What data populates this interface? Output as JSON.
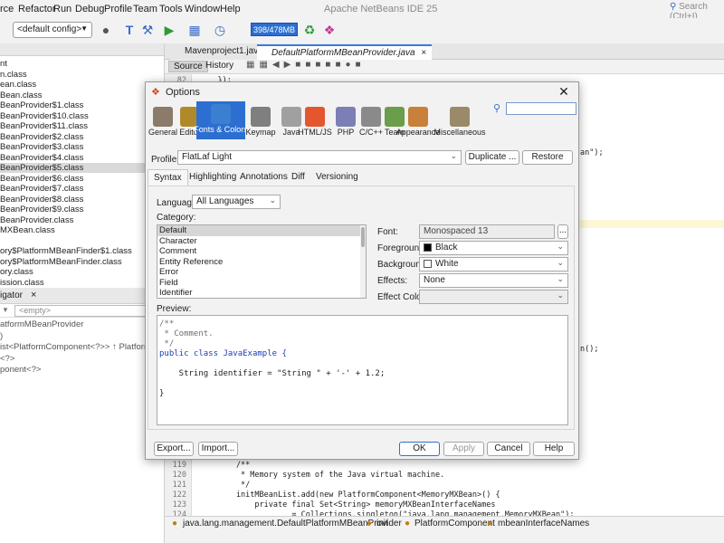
{
  "menubar": {
    "items": [
      "rce",
      "Refactor",
      "Run",
      "Debug",
      "Profile",
      "Team",
      "Tools",
      "Window",
      "Help"
    ],
    "app_title": "Apache NetBeans IDE 25",
    "search_placeholder": "Search (Ctrl+I)"
  },
  "toolbar": {
    "config": "<default config>",
    "memory": "398/478MB"
  },
  "project_tree": {
    "items": [
      "nt",
      "n.class",
      "ean.class",
      "Bean.class",
      "BeanProvider$1.class",
      "BeanProvider$10.class",
      "BeanProvider$11.class",
      "BeanProvider$2.class",
      "BeanProvider$3.class",
      "BeanProvider$4.class",
      "BeanProvider$5.class",
      "BeanProvider$6.class",
      "BeanProvider$7.class",
      "BeanProvider$8.class",
      "BeanProvider$9.class",
      "BeanProvider.class",
      "MXBean.class",
      "",
      "ory$PlatformMBeanFinder$1.class",
      "ory$PlatformMBeanFinder.class",
      "ory.class",
      "ission.class"
    ],
    "selected_index": 10
  },
  "navigator": {
    "tab": "igator",
    "filter": "<empty>",
    "items": [
      "atformMBeanProvider",
      ")",
      "ist<PlatformComponent<?>> ↑ PlatformMBean",
      "<?>",
      "ponent<?>"
    ]
  },
  "editor": {
    "tabs": [
      "Mavenproject1.java",
      "DefaultPlatformMBeanProvider.java"
    ],
    "active_tab": 1,
    "source_label": "Source",
    "history_label": "History",
    "top_lines": [
      {
        "num": "82",
        "code": "    });"
      },
      {
        "num": "83",
        "code": ""
      }
    ],
    "right_fragments": [
      "an\");",
      "n();"
    ],
    "bottom_lines": [
      {
        "num": "119",
        "code": "        /**"
      },
      {
        "num": "120",
        "code": "         * Memory system of the Java virtual machine."
      },
      {
        "num": "121",
        "code": "         */"
      },
      {
        "num": "122",
        "code": "        initMBeanList.add(new PlatformComponent<MemoryMXBean>() {"
      },
      {
        "num": "123",
        "code": "            private final Set<String> memoryMXBeanInterfaceNames"
      },
      {
        "num": "124",
        "code": "                    = Collections.singleton(\"java.lang.management.MemoryMXBean\");"
      }
    ],
    "breadcrumbs": [
      "java.lang.management.DefaultPlatformMBeanProvider",
      "init",
      "PlatformComponent",
      "mbeanInterfaceNames"
    ]
  },
  "dialog": {
    "title": "Options",
    "categories": [
      {
        "label": "General",
        "icon": "general-icon",
        "color": "#8a7b6a"
      },
      {
        "label": "Editor",
        "icon": "editor-icon",
        "color": "#b08a2a"
      },
      {
        "label": "Fonts & Colors",
        "icon": "fonts-colors-icon",
        "color": "#3a7fd0"
      },
      {
        "label": "Keymap",
        "icon": "keymap-icon",
        "color": "#7f7f7f"
      },
      {
        "label": "Java",
        "icon": "java-icon",
        "color": "#a0a0a0"
      },
      {
        "label": "HTML/JS",
        "icon": "html5-icon",
        "color": "#e4572e"
      },
      {
        "label": "PHP",
        "icon": "php-icon",
        "color": "#7b7fb5"
      },
      {
        "label": "C/C++",
        "icon": "cpp-icon",
        "color": "#8a8a8a"
      },
      {
        "label": "Team",
        "icon": "team-icon",
        "color": "#6a9e4a"
      },
      {
        "label": "Appearance",
        "icon": "appearance-icon",
        "color": "#c8803a"
      },
      {
        "label": "Miscellaneous",
        "icon": "miscellaneous-icon",
        "color": "#9a8a6a"
      }
    ],
    "active_category": 2,
    "profile_label": "Profile:",
    "profile_value": "FlatLaf Light",
    "duplicate_label": "Duplicate ...",
    "restore_label": "Restore",
    "subtabs": [
      "Syntax",
      "Highlighting",
      "Annotations",
      "Diff",
      "Versioning"
    ],
    "active_subtab": 0,
    "language_label": "Language:",
    "language_value": "All Languages",
    "category_label": "Category:",
    "category_items": [
      "Default",
      "Character",
      "Comment",
      "Entity Reference",
      "Error",
      "Field",
      "Identifier"
    ],
    "selected_category": 0,
    "font_label": "Font:",
    "font_value": "Monospaced 13",
    "font_browse": "...",
    "foreground_label": "Foreground:",
    "foreground_value": "Black",
    "foreground_color": "#000000",
    "background_label": "Background:",
    "background_value": "White",
    "background_color": "#ffffff",
    "effects_label": "Effects:",
    "effects_value": "None",
    "effect_color_label": "Effect Color:",
    "preview_label": "Preview:",
    "preview_lines": [
      "/**",
      " * Comment.",
      " */",
      "public class JavaExample {",
      "",
      "    String identifier = \"String \" + '-' + 1.2;",
      "",
      "}"
    ],
    "export_label": "Export...",
    "import_label": "Import...",
    "ok_label": "OK",
    "apply_label": "Apply",
    "cancel_label": "Cancel",
    "help_label": "Help"
  },
  "colors": {
    "accent": "#2d6fd1",
    "keyword": "#1a3fb5",
    "string": "#c27a1e",
    "comment": "#6f6f6f"
  }
}
